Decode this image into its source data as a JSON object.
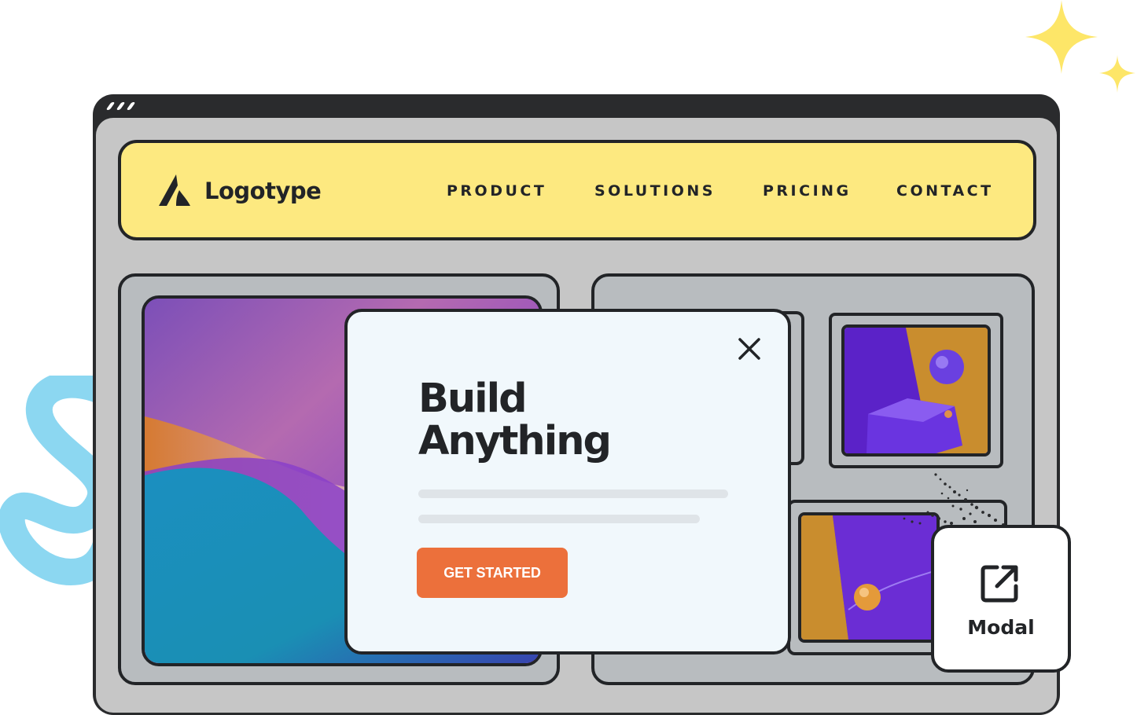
{
  "navbar": {
    "logo_text": "Logotype",
    "links": [
      "PRODUCT",
      "SOLUTIONS",
      "PRICING",
      "CONTACT"
    ]
  },
  "modal": {
    "title_line1": "Build",
    "title_line2": "Anything",
    "cta_label": "GET STARTED"
  },
  "badge": {
    "label": "Modal",
    "icon": "external-link-icon"
  },
  "colors": {
    "navbar_bg": "#fde980",
    "cta_bg": "#ec703b",
    "modal_bg": "#f1f8fc",
    "outline": "#222427",
    "sparkle": "#fde668",
    "squiggle": "#7fd3ef"
  }
}
